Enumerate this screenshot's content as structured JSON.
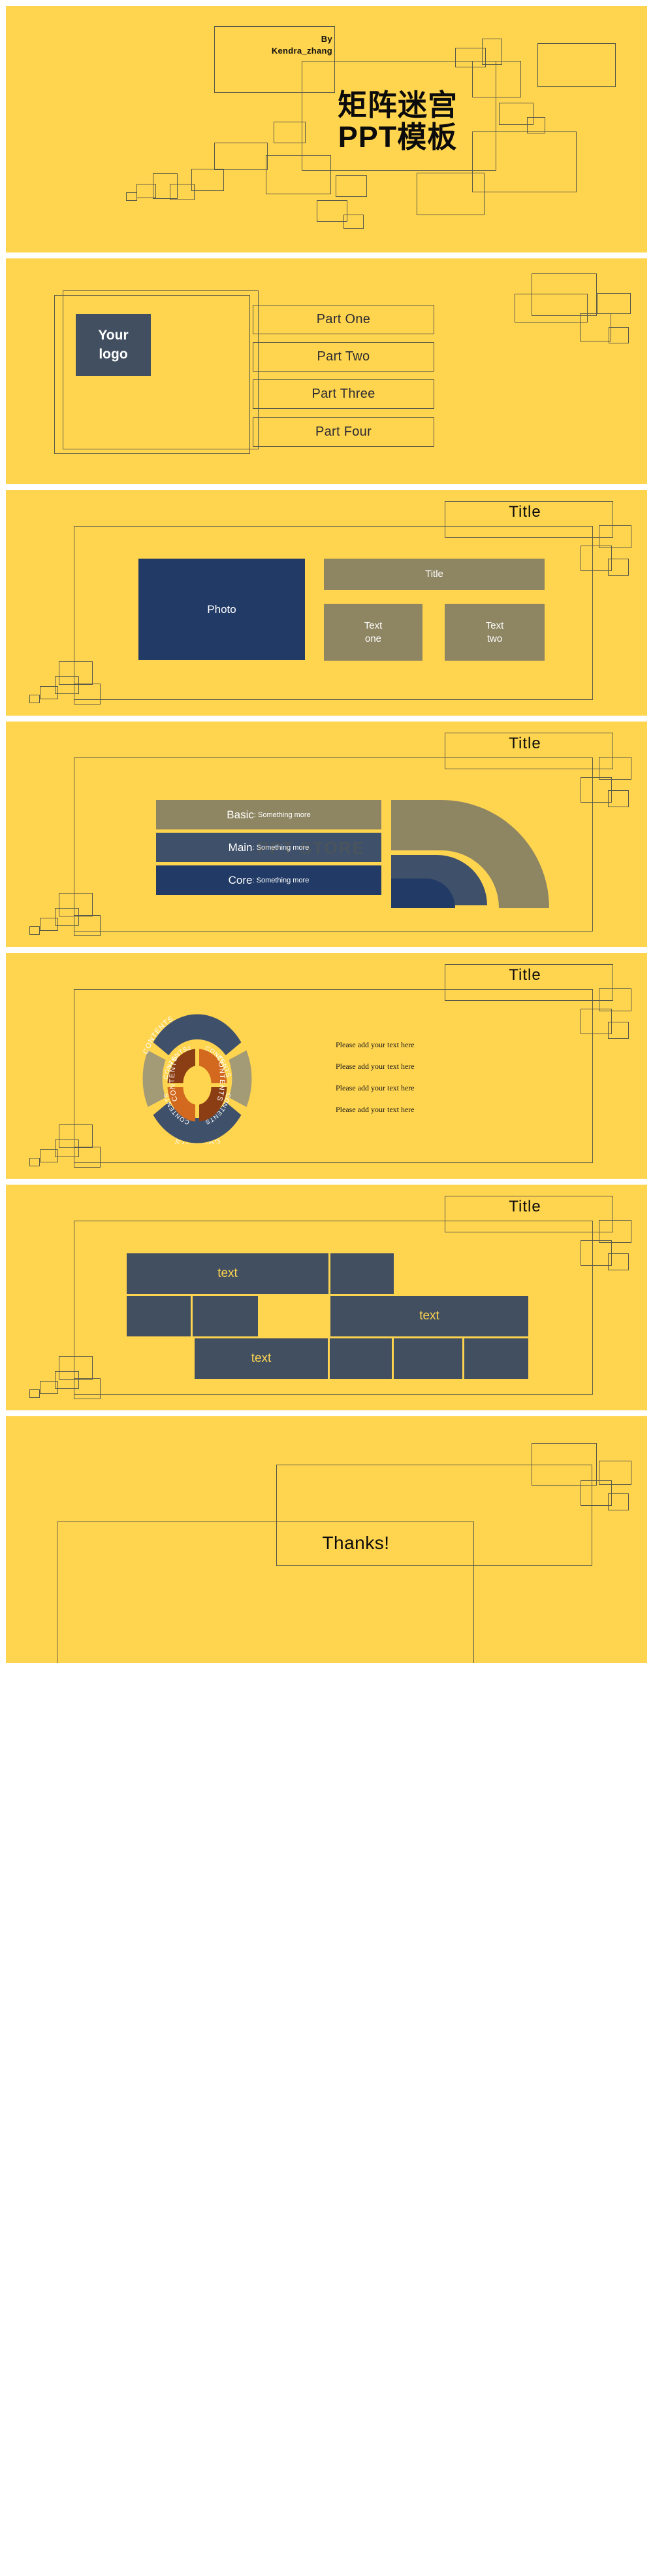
{
  "theme": {
    "background": "#FFD44F",
    "navy": "#223B66",
    "slate": "#414F61",
    "olive": "#8E8663",
    "line": "#5a5a4a",
    "text_dark": "#0b0b0b",
    "text_light": "#ffffff"
  },
  "slide1": {
    "byline_line1": "By",
    "byline_line2": "Kendra_zhang",
    "title_line1": "矩阵迷宫",
    "title_line2": "PPT模板"
  },
  "slide2": {
    "logo_line1": "Your",
    "logo_line2": "logo",
    "parts": [
      {
        "label": "Part One"
      },
      {
        "label": "Part Two"
      },
      {
        "label": "Part Three"
      },
      {
        "label": "Part Four"
      }
    ]
  },
  "slide3": {
    "title": "Title",
    "photo_label": "Photo",
    "panel_title": "Title",
    "text_one_line1": "Text",
    "text_one_line2": "one",
    "text_two_line1": "Text",
    "text_two_line2": "two"
  },
  "slide4": {
    "title": "Title",
    "watermark": "PPT STORE",
    "rows": [
      {
        "lead": "Basic",
        "tail": ": Something more",
        "color": "#8E8663"
      },
      {
        "lead": "Main",
        "tail": ": Something more",
        "color": "#3F506B"
      },
      {
        "lead": "Core",
        "tail": ": Something more",
        "color": "#223B66"
      }
    ]
  },
  "slide5": {
    "title": "Title",
    "outer_segments": [
      {
        "label": "CONTENTS",
        "color": "#3F506B"
      },
      {
        "label": "CONTENTS",
        "color": "#A39A76"
      },
      {
        "label": "CONTENTS",
        "color": "#3F506B"
      },
      {
        "label": "CONTENTS",
        "color": "#A39A76"
      }
    ],
    "inner_segments": [
      {
        "label": "CONTENTSz",
        "color": "#8B3E14"
      },
      {
        "label": "CONTENTS",
        "color": "#D2691E"
      },
      {
        "label": "CONTENTS",
        "color": "#8B3E14"
      },
      {
        "label": "CONTENTS",
        "color": "#D2691E"
      }
    ],
    "bullets": [
      "Please add your text here",
      "Please add your text here",
      "Please add your text here",
      "Please add your text here"
    ]
  },
  "slide6": {
    "title": "Title",
    "blocks": [
      {
        "label": "text"
      },
      {
        "label": ""
      },
      {
        "label": ""
      },
      {
        "label": ""
      },
      {
        "label": "text"
      },
      {
        "label": "text"
      },
      {
        "label": ""
      },
      {
        "label": ""
      },
      {
        "label": ""
      }
    ]
  },
  "slide7": {
    "thanks": "Thanks!"
  }
}
